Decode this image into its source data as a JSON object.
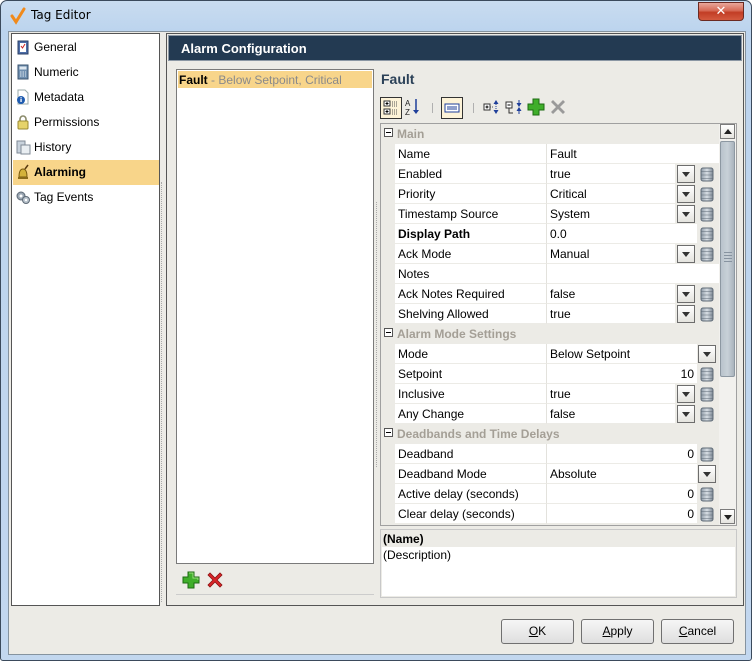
{
  "window": {
    "title": "Tag Editor",
    "close_label": "✕"
  },
  "sidebar": {
    "items": [
      {
        "label": "General",
        "icon": "clipboard-icon",
        "active": false
      },
      {
        "label": "Numeric",
        "icon": "calculator-icon",
        "active": false
      },
      {
        "label": "Metadata",
        "icon": "info-icon",
        "active": false
      },
      {
        "label": "Permissions",
        "icon": "lock-icon",
        "active": false
      },
      {
        "label": "History",
        "icon": "history-icon",
        "active": false
      },
      {
        "label": "Alarming",
        "icon": "bell-icon",
        "active": true
      },
      {
        "label": "Tag Events",
        "icon": "gears-icon",
        "active": false
      }
    ]
  },
  "panel": {
    "header": "Alarm Configuration"
  },
  "alarm_list": {
    "items": [
      {
        "name": "Fault",
        "separator": " - ",
        "summary": "Below Setpoint, Critical",
        "selected": true
      }
    ],
    "add_icon": "add-icon",
    "delete_icon": "delete-icon"
  },
  "properties": {
    "title": "Fault",
    "toolbar": [
      {
        "name": "categorized-view",
        "pressed": true
      },
      {
        "name": "alphabetical-sort",
        "pressed": false
      },
      {
        "name": "description-toggle",
        "pressed": true
      },
      {
        "name": "expand-all",
        "pressed": false
      },
      {
        "name": "collapse-all",
        "pressed": false
      },
      {
        "name": "add",
        "pressed": false
      },
      {
        "name": "remove",
        "pressed": false,
        "disabled": true
      }
    ],
    "categories": [
      {
        "label": "Main",
        "rows": [
          {
            "key": "Name",
            "value": "Fault",
            "dropdown": false,
            "binding": false,
            "bold": false
          },
          {
            "key": "Enabled",
            "value": "true",
            "dropdown": true,
            "binding": true,
            "bold": false
          },
          {
            "key": "Priority",
            "value": "Critical",
            "dropdown": true,
            "binding": true,
            "bold": false
          },
          {
            "key": "Timestamp Source",
            "value": "System",
            "dropdown": true,
            "binding": true,
            "bold": false
          },
          {
            "key": "Display Path",
            "value": "0.0",
            "dropdown": false,
            "binding": true,
            "bold": true
          },
          {
            "key": "Ack Mode",
            "value": "Manual",
            "dropdown": true,
            "binding": true,
            "bold": false
          },
          {
            "key": "Notes",
            "value": "",
            "dropdown": false,
            "binding": false,
            "bold": false
          },
          {
            "key": "Ack Notes Required",
            "value": "false",
            "dropdown": true,
            "binding": true,
            "bold": false
          },
          {
            "key": "Shelving Allowed",
            "value": "true",
            "dropdown": true,
            "binding": true,
            "bold": false
          }
        ]
      },
      {
        "label": "Alarm Mode Settings",
        "rows": [
          {
            "key": "Mode",
            "value": "Below Setpoint",
            "dropdown": true,
            "binding": false,
            "bold": false
          },
          {
            "key": "Setpoint",
            "value": "10",
            "dropdown": false,
            "binding": true,
            "bold": false,
            "numeric": true
          },
          {
            "key": "Inclusive",
            "value": "true",
            "dropdown": true,
            "binding": true,
            "bold": false
          },
          {
            "key": "Any Change",
            "value": "false",
            "dropdown": true,
            "binding": true,
            "bold": false
          }
        ]
      },
      {
        "label": "Deadbands and Time Delays",
        "rows": [
          {
            "key": "Deadband",
            "value": "0",
            "dropdown": false,
            "binding": true,
            "bold": false,
            "numeric": true
          },
          {
            "key": "Deadband Mode",
            "value": "Absolute",
            "dropdown": true,
            "binding": false,
            "bold": false
          },
          {
            "key": "Active delay (seconds)",
            "value": "0",
            "dropdown": false,
            "binding": true,
            "bold": false,
            "numeric": true
          },
          {
            "key": "Clear delay (seconds)",
            "value": "0",
            "dropdown": false,
            "binding": true,
            "bold": false,
            "numeric": true
          }
        ]
      }
    ],
    "description": {
      "name": "(Name)",
      "text": "(Description)"
    }
  },
  "buttons": {
    "ok": {
      "mnemonic": "O",
      "rest": "K"
    },
    "apply": {
      "mnemonic": "A",
      "rest": "pply"
    },
    "cancel": {
      "mnemonic": "C",
      "rest": "ancel"
    }
  }
}
